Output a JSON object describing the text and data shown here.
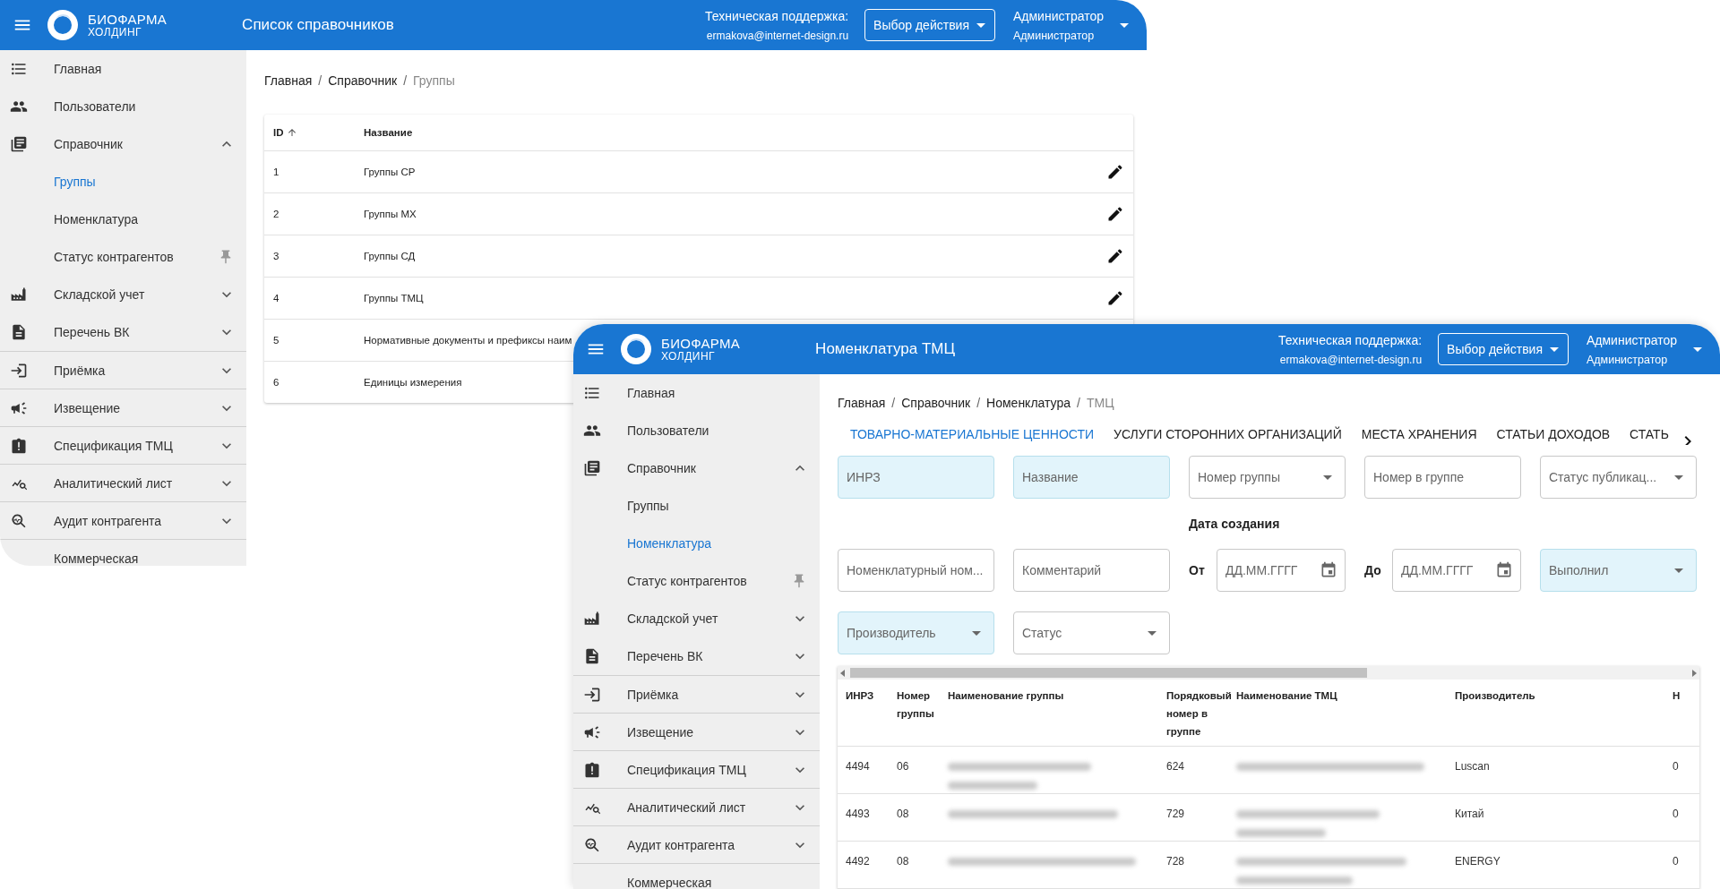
{
  "windows": [
    {
      "header": {
        "brand": "БИОФАРМА",
        "brand_subtitle": "ХОЛДИНГ",
        "title": "Список справочников",
        "support_label": "Техническая поддержка:",
        "support_email": "ermakova@internet-design.ru",
        "action_button": "Выбор действия",
        "user_name": "Администратор",
        "user_role": "Администратор"
      },
      "sidebar": [
        {
          "label": "Главная"
        },
        {
          "label": "Пользователи"
        },
        {
          "label": "Справочник",
          "expanded": true,
          "children": [
            {
              "label": "Группы",
              "selected": true,
              "pinned": false
            },
            {
              "label": "Номенклатура",
              "selected": false,
              "pinned": false
            },
            {
              "label": "Статус контрагентов",
              "selected": false,
              "pinned": true
            }
          ]
        },
        {
          "label": "Складской учет",
          "expanded": false
        },
        {
          "label": "Перечень ВК",
          "expanded": false
        },
        {
          "label": "Приёмка",
          "expanded": false
        },
        {
          "label": "Извещение",
          "expanded": false
        },
        {
          "label": "Спецификация ТМЦ",
          "expanded": false
        },
        {
          "label": "Аналитический лист",
          "expanded": false
        },
        {
          "label": "Аудит контрагента",
          "expanded": false
        },
        {
          "label": "Коммерческая"
        }
      ],
      "breadcrumbs": [
        "Главная",
        "/",
        "Справочник",
        "/",
        "Группы"
      ],
      "content": {
        "kind": "groups_table",
        "columns": [
          "ID",
          "Название"
        ],
        "rows": [
          {
            "id": "1",
            "name": "Группы СР",
            "editable": true
          },
          {
            "id": "2",
            "name": "Группы МХ",
            "editable": true
          },
          {
            "id": "3",
            "name": "Группы СД",
            "editable": true
          },
          {
            "id": "4",
            "name": "Группы ТМЦ",
            "editable": true
          },
          {
            "id": "5",
            "name": "Нормативные документы и префиксы наим",
            "editable": false
          },
          {
            "id": "6",
            "name": "Единицы измерения",
            "editable": false
          }
        ]
      }
    },
    {
      "header": {
        "brand": "БИОФАРМА",
        "brand_subtitle": "ХОЛДИНГ",
        "title": "Номенклатура ТМЦ",
        "support_label": "Техническая поддержка:",
        "support_email": "ermakova@internet-design.ru",
        "action_button": "Выбор действия",
        "user_name": "Администратор",
        "user_role": "Администратор"
      },
      "sidebar": [
        {
          "label": "Главная"
        },
        {
          "label": "Пользователи"
        },
        {
          "label": "Справочник",
          "expanded": true,
          "children": [
            {
              "label": "Группы",
              "selected": false,
              "pinned": false
            },
            {
              "label": "Номенклатура",
              "selected": true,
              "pinned": false
            },
            {
              "label": "Статус контрагентов",
              "selected": false,
              "pinned": true
            }
          ]
        },
        {
          "label": "Складской учет",
          "expanded": false
        },
        {
          "label": "Перечень ВК",
          "expanded": false
        },
        {
          "label": "Приёмка",
          "expanded": false
        },
        {
          "label": "Извещение",
          "expanded": false
        },
        {
          "label": "Спецификация ТМЦ",
          "expanded": false
        },
        {
          "label": "Аналитический лист",
          "expanded": false
        },
        {
          "label": "Аудит контрагента",
          "expanded": false
        },
        {
          "label": "Коммерческая"
        }
      ],
      "breadcrumbs": [
        "Главная",
        "/",
        "Справочник",
        "/",
        "Номенклатура",
        "/",
        "ТМЦ"
      ],
      "content": {
        "kind": "nomenclature",
        "tabs": [
          {
            "label": "ТОВАРНО-МАТЕРИАЛЬНЫЕ ЦЕННОСТИ",
            "selected": true
          },
          {
            "label": "УСЛУГИ СТОРОННИХ ОРГАНИЗАЦИЙ",
            "selected": false
          },
          {
            "label": "МЕСТА ХРАНЕНИЯ",
            "selected": false
          },
          {
            "label": "СТАТЬИ ДОХОДОВ",
            "selected": false
          },
          {
            "label": "СТАТЬ",
            "selected": false
          }
        ],
        "filter_rows": [
          {
            "items": [
              {
                "kind": "text",
                "placeholder": "ИНРЗ",
                "highlighted": true
              },
              {
                "kind": "text",
                "placeholder": "Название",
                "highlighted": true
              },
              {
                "kind": "select",
                "placeholder": "Номер группы",
                "highlighted": false
              },
              {
                "kind": "text",
                "placeholder": "Номер в группе",
                "highlighted": false
              },
              {
                "kind": "select",
                "placeholder": "Статус публикац...",
                "highlighted": false
              }
            ]
          },
          {
            "caption": "Дата создания",
            "items": [
              {
                "kind": "text",
                "placeholder": "Номенклатурный ном...",
                "highlighted": false
              },
              {
                "kind": "text",
                "placeholder": "Комментарий",
                "highlighted": false
              },
              {
                "kind": "date",
                "label": "От",
                "placeholder": "ДД.ММ.ГГГГ",
                "highlighted": false
              },
              {
                "kind": "date",
                "label": "До",
                "placeholder": "ДД.ММ.ГГГГ",
                "highlighted": false
              },
              {
                "kind": "select",
                "placeholder": "Выполнил",
                "highlighted": true
              }
            ]
          },
          {
            "items": [
              {
                "kind": "select",
                "placeholder": "Производитель",
                "highlighted": true
              },
              {
                "kind": "select",
                "placeholder": "Статус",
                "highlighted": false
              }
            ]
          }
        ],
        "table": {
          "columns": [
            "ИНРЗ",
            "Номер группы",
            "Наименование группы",
            "Порядковый номер в группе",
            "Наименование ТМЦ",
            "Производитель",
            "Н"
          ],
          "rows": [
            {
              "cells": [
                "4494",
                "06",
                {
                  "blurred": true,
                  "wraps": true
                },
                "624",
                {
                  "blurred": true,
                  "wraps": false
                },
                "Luscan",
                "0"
              ]
            },
            {
              "cells": [
                "4493",
                "08",
                {
                  "blurred": true,
                  "wraps": false
                },
                "729",
                {
                  "blurred": true,
                  "wraps": true
                },
                "Китай",
                "0"
              ]
            },
            {
              "cells": [
                "4492",
                "08",
                {
                  "blurred": true,
                  "wraps": false
                },
                "728",
                {
                  "blurred": true,
                  "wraps": true
                },
                "ENERGY",
                "0"
              ]
            }
          ]
        }
      }
    }
  ]
}
